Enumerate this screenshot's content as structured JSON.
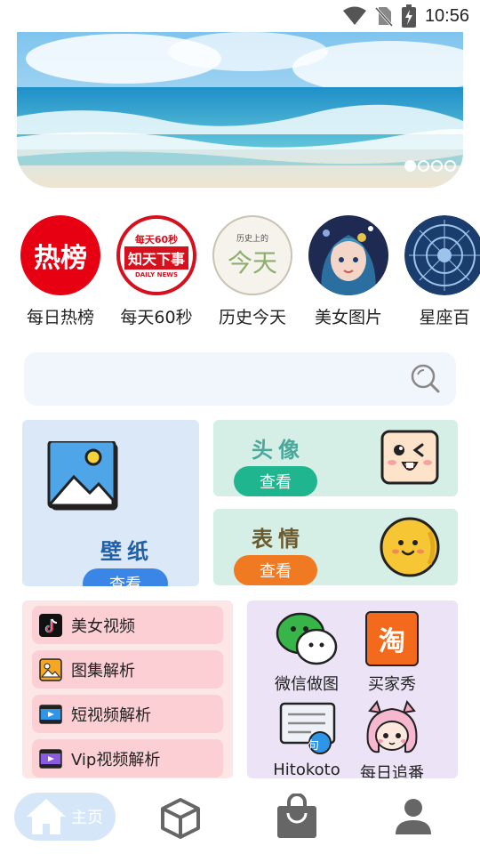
{
  "status": {
    "time": "10:56"
  },
  "banner": {
    "slides": 4,
    "active_index": 0
  },
  "quick_links": [
    {
      "label": "每日热榜",
      "badge_text": "热榜"
    },
    {
      "label": "每天60秒",
      "badge_top": "每天60秒",
      "badge_main": "知天下事",
      "badge_sub": "DAILY NEWS"
    },
    {
      "label": "历史今天",
      "badge_top": "历史上的",
      "badge_main": "今天"
    },
    {
      "label": "美女图片"
    },
    {
      "label": "星座百"
    }
  ],
  "search": {
    "placeholder": ""
  },
  "cards": {
    "wallpaper": {
      "title": "壁纸",
      "button": "查看"
    },
    "avatar": {
      "title": "头像",
      "button": "查看"
    },
    "emoji": {
      "title": "表情",
      "button": "查看"
    }
  },
  "video_items": [
    {
      "label": "美女视频",
      "icon": "tiktok-icon"
    },
    {
      "label": "图集解析",
      "icon": "album-icon"
    },
    {
      "label": "短视频解析",
      "icon": "film-icon"
    },
    {
      "label": "Vip视频解析",
      "icon": "film-purple-icon"
    }
  ],
  "apps": [
    {
      "label": "微信做图",
      "icon": "wechat-icon"
    },
    {
      "label": "买家秀",
      "icon": "taobao-icon",
      "icon_text": "淘"
    },
    {
      "label": "Hitokoto",
      "icon": "quote-icon",
      "icon_text": "句"
    },
    {
      "label": "每日追番",
      "icon": "anime-icon"
    }
  ],
  "bottom_nav": {
    "home_label": "主页"
  },
  "colors": {
    "accent": "#3a86e6",
    "green": "#1fb58e",
    "orange": "#f07a22"
  }
}
